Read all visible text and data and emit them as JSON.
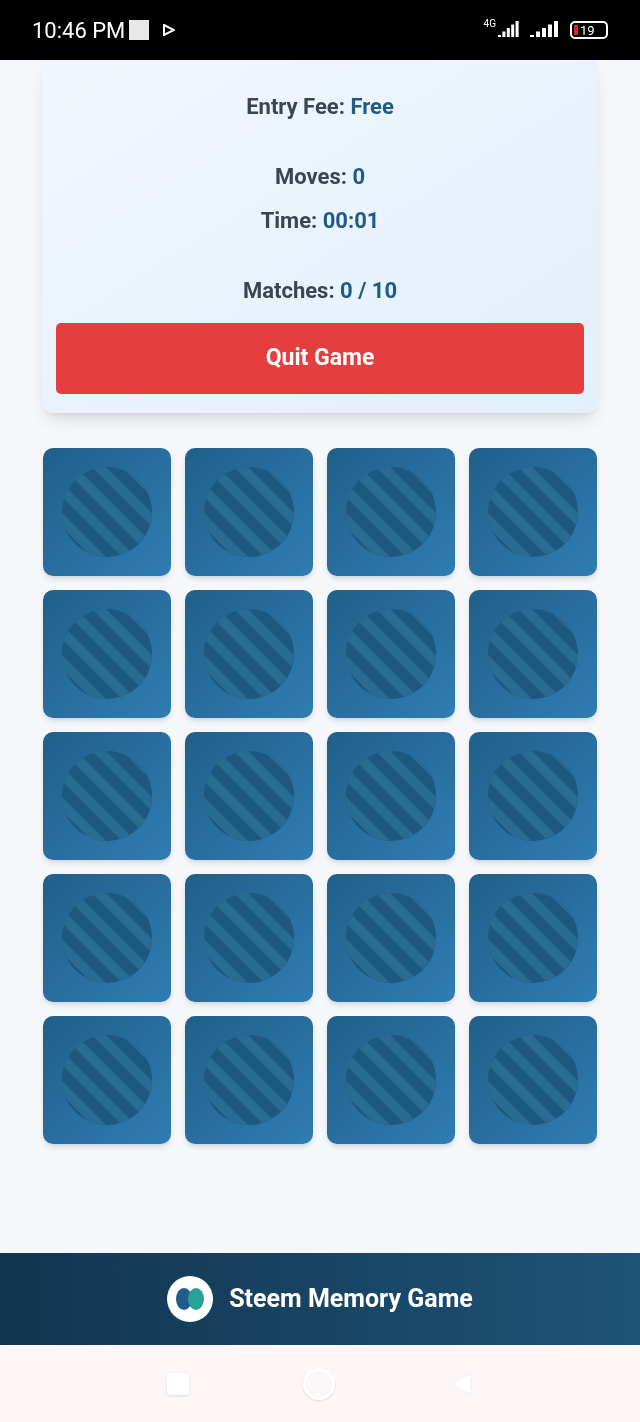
{
  "status_bar": {
    "time": "10:46 PM",
    "network": "4G",
    "battery": "19"
  },
  "game_panel": {
    "entry_fee": {
      "label": "Entry Fee:",
      "value": "Free"
    },
    "moves": {
      "label": "Moves:",
      "value": "0"
    },
    "time": {
      "label": "Time:",
      "value": "00:01"
    },
    "matches": {
      "label": "Matches:",
      "value": "0 / 10"
    },
    "quit_button": "Quit Game"
  },
  "cards": [
    {
      "face_down": true
    },
    {
      "face_down": true
    },
    {
      "face_down": true
    },
    {
      "face_down": true
    },
    {
      "face_down": true
    },
    {
      "face_down": true
    },
    {
      "face_down": true
    },
    {
      "face_down": true
    },
    {
      "face_down": true
    },
    {
      "face_down": true
    },
    {
      "face_down": true
    },
    {
      "face_down": true
    },
    {
      "face_down": true
    },
    {
      "face_down": true
    },
    {
      "face_down": true
    },
    {
      "face_down": true
    },
    {
      "face_down": true
    },
    {
      "face_down": true
    },
    {
      "face_down": true
    },
    {
      "face_down": true
    }
  ],
  "footer": {
    "title": "Steem Memory Game"
  }
}
